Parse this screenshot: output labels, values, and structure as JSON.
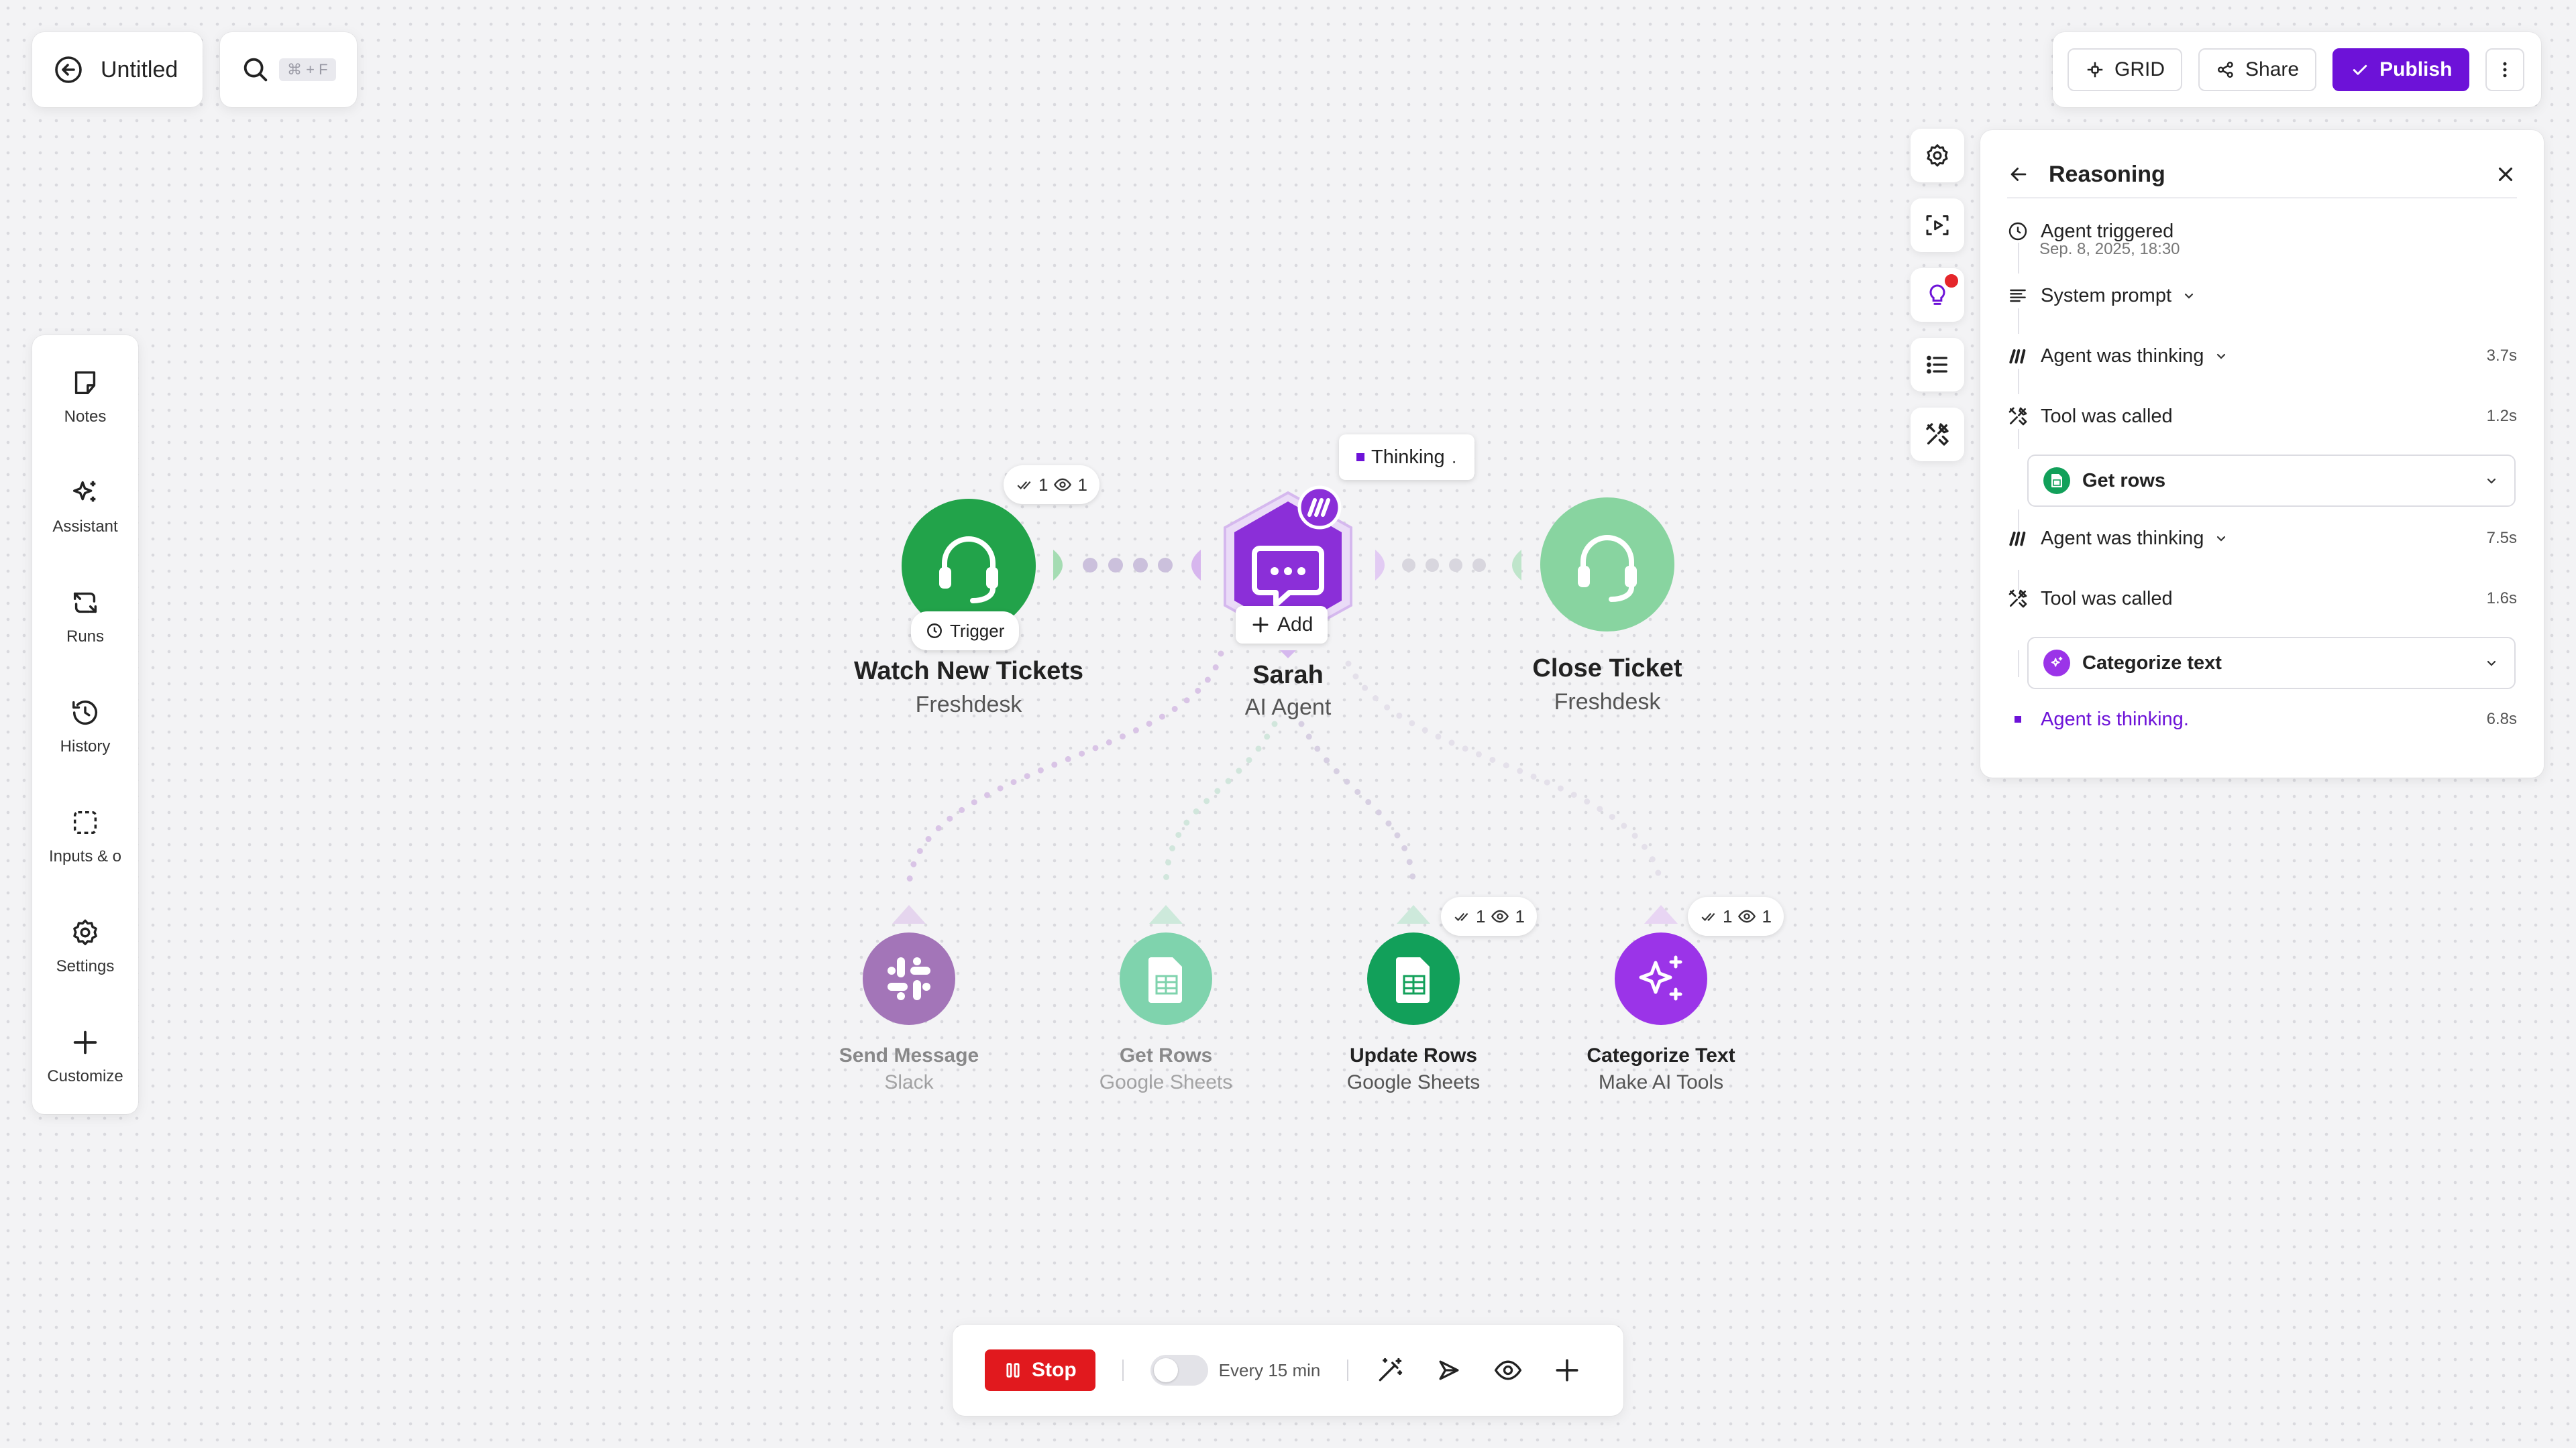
{
  "header": {
    "title": "Untitled",
    "search_shortcut": "⌘ + F"
  },
  "toolbar": {
    "grid_label": "GRID",
    "share_label": "Share",
    "publish_label": "Publish"
  },
  "sidebar": {
    "items": [
      {
        "label": "Notes",
        "icon": "note-icon"
      },
      {
        "label": "Assistant",
        "icon": "sparkles-icon"
      },
      {
        "label": "Runs",
        "icon": "runs-icon"
      },
      {
        "label": "History",
        "icon": "history-icon"
      },
      {
        "label": "Inputs & o",
        "icon": "inputs-icon"
      },
      {
        "label": "Settings",
        "icon": "gear-icon"
      },
      {
        "label": "Customize",
        "icon": "plus-icon"
      }
    ]
  },
  "canvas": {
    "trigger": {
      "title": "Watch New Tickets",
      "subtitle": "Freshdesk",
      "tag": "Trigger",
      "ops": "1",
      "views": "1",
      "color": "#22a34a"
    },
    "agent": {
      "title": "Sarah",
      "subtitle": "AI Agent",
      "status": "Thinking",
      "add_label": "Add",
      "color": "#8b2fd8"
    },
    "close": {
      "title": "Close Ticket",
      "subtitle": "Freshdesk",
      "color": "#88d4a0"
    },
    "tools": [
      {
        "title": "Send Message",
        "subtitle": "Slack",
        "color": "#a375b8",
        "icon": "slack-icon"
      },
      {
        "title": "Get Rows",
        "subtitle": "Google Sheets",
        "color": "#7fd3ad",
        "icon": "sheets-icon"
      },
      {
        "title": "Update Rows",
        "subtitle": "Google Sheets",
        "color": "#12a05a",
        "icon": "sheets-icon",
        "ops": "1",
        "views": "1"
      },
      {
        "title": "Categorize Text",
        "subtitle": "Make AI Tools",
        "color": "#9b34e8",
        "icon": "sparkles-icon",
        "ops": "1",
        "views": "1"
      }
    ]
  },
  "reasoning": {
    "title": "Reasoning",
    "events": [
      {
        "label": "Agent triggered",
        "sub": "Sep. 8, 2025, 18:30"
      },
      {
        "label": "System prompt"
      },
      {
        "label": "Agent was thinking",
        "duration": "3.7s"
      },
      {
        "label": "Tool was called",
        "duration": "1.2s",
        "tool": "Get rows"
      },
      {
        "label": "Agent was thinking",
        "duration": "7.5s"
      },
      {
        "label": "Tool was called",
        "duration": "1.6s",
        "tool": "Categorize text"
      },
      {
        "label": "Agent is thinking",
        "duration": "6.8s"
      }
    ],
    "accent": "#6d12d8"
  },
  "bottom_bar": {
    "stop_label": "Stop",
    "schedule": "Every 15 min"
  }
}
